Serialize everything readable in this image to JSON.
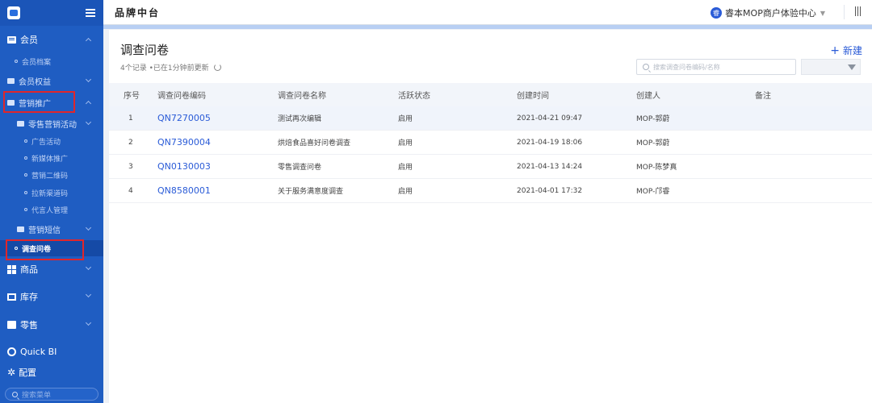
{
  "sidebar": {
    "items": [
      {
        "label": "会员"
      },
      {
        "label": "会员档案"
      },
      {
        "label": "会员权益"
      },
      {
        "label": "营销推广"
      },
      {
        "label": "零售营销活动"
      },
      {
        "label": "广告活动"
      },
      {
        "label": "新媒体推广"
      },
      {
        "label": "营销二维码"
      },
      {
        "label": "拉新渠道码"
      },
      {
        "label": "代言人管理"
      },
      {
        "label": "营销短信"
      },
      {
        "label": "调查问卷"
      },
      {
        "label": "商品"
      },
      {
        "label": "库存"
      },
      {
        "label": "零售"
      },
      {
        "label": "Quick BI"
      },
      {
        "label": "配置"
      }
    ],
    "search_placeholder": "搜索菜单"
  },
  "topbar": {
    "title": "品牌中台",
    "merchant_avatar": "睿",
    "merchant_name": "睿本MOP商户体验中心"
  },
  "page": {
    "title": "调查问卷",
    "meta": "4个记录 •已在1分钟前更新",
    "new_button": "新建",
    "search_placeholder": "搜索调查问卷编码/名称"
  },
  "table": {
    "headers": [
      "序号",
      "调查问卷编码",
      "调查问卷名称",
      "活跃状态",
      "创建时间",
      "创建人",
      "备注"
    ],
    "rows": [
      {
        "seq": "1",
        "code": "QN7270005",
        "name": "测试再次编辑",
        "status": "启用",
        "created": "2021-04-21 09:47",
        "creator": "MOP-郭蔚",
        "note": ""
      },
      {
        "seq": "2",
        "code": "QN7390004",
        "name": "烘焙食品喜好问卷调查",
        "status": "启用",
        "created": "2021-04-19 18:06",
        "creator": "MOP-郭蔚",
        "note": ""
      },
      {
        "seq": "3",
        "code": "QN0130003",
        "name": "零售调查问卷",
        "status": "启用",
        "created": "2021-04-13 14:24",
        "creator": "MOP-陈梦真",
        "note": ""
      },
      {
        "seq": "4",
        "code": "QN8580001",
        "name": "关于服务满意度调查",
        "status": "启用",
        "created": "2021-04-01 17:32",
        "creator": "MOP-邝睿",
        "note": ""
      }
    ]
  },
  "colors": {
    "sidebar_bg": "#1f5dc2",
    "accent": "#2a5bd7",
    "highlight_box": "#e0262b"
  }
}
